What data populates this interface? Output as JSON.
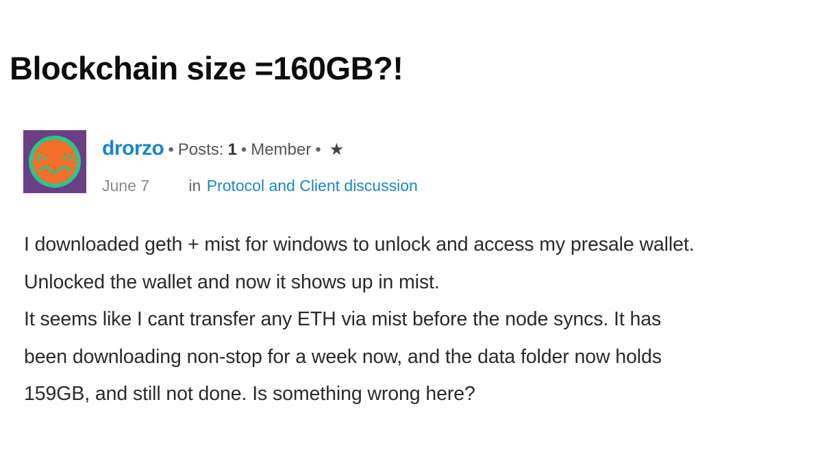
{
  "post": {
    "title": "Blockchain size =160GB?!",
    "author": {
      "name": "drorzo",
      "avatar_icon": "smiley-face-icon",
      "avatar_bg": "#6b3f86",
      "avatar_face": "#f36f2a",
      "avatar_ring": "#2ec48a"
    },
    "meta": {
      "bullet": "•",
      "posts_label": "Posts:",
      "posts_count": "1",
      "role": "Member",
      "star": "★",
      "date": "June 7",
      "in_label": "in",
      "category": "Protocol and Client discussion"
    },
    "body_lines": [
      "I downloaded geth + mist for windows to unlock and access my presale wallet.",
      "Unlocked the wallet and now it shows up in mist.",
      "It seems like I cant transfer any ETH via mist before the node syncs. It has",
      "been downloading non-stop for a week now, and the data folder now holds",
      "159GB, and still not done. Is something wrong here?"
    ]
  }
}
